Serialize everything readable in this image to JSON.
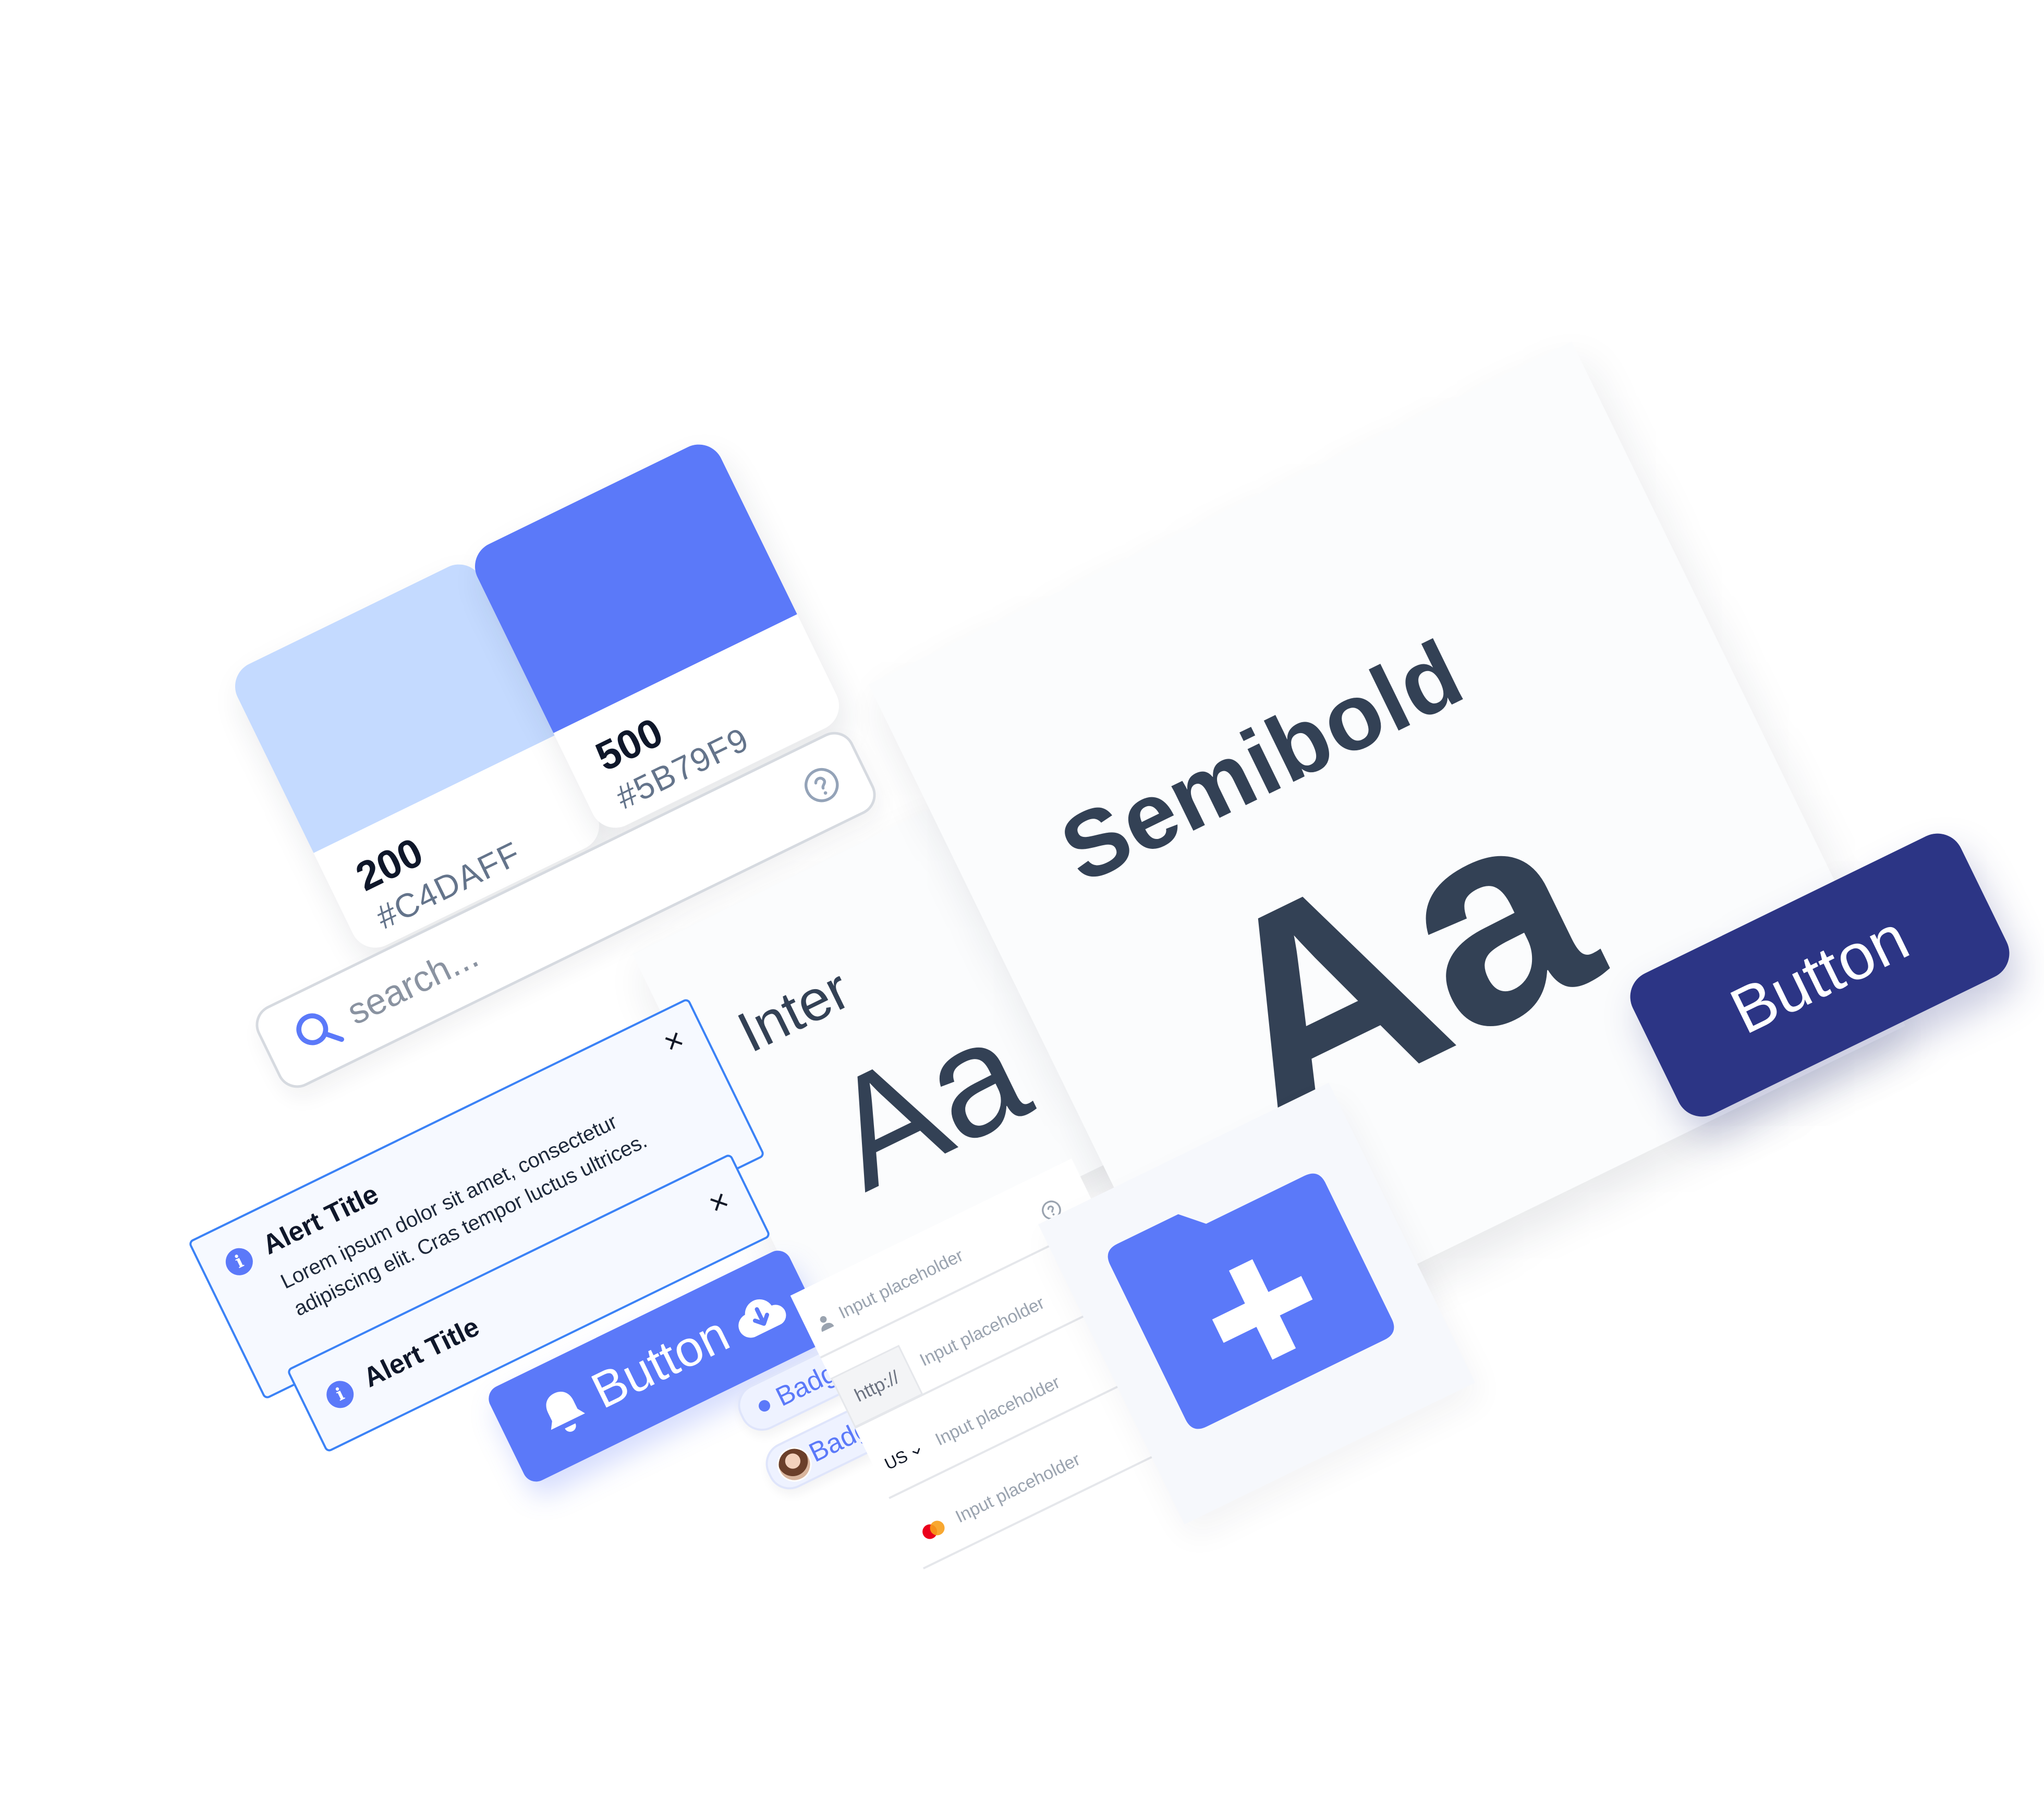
{
  "swatches": [
    {
      "level": "200",
      "hex": "#C4DAFF",
      "color": "#C4DAFF"
    },
    {
      "level": "500",
      "hex": "#5B79F9",
      "color": "#5B79F9"
    }
  ],
  "search": {
    "placeholder": "search..."
  },
  "alerts": [
    {
      "title": "Alert Title",
      "body": "Lorem ipsum dolor sit amet, consectetur adipiscing elit. Cras tempor luctus ultrices.",
      "close": "×"
    },
    {
      "title": "Alert Title",
      "close": "×"
    }
  ],
  "alert_icon": "i",
  "typography": [
    {
      "name": "Inter",
      "sample": "Aa"
    },
    {
      "name": "Semibold",
      "sample": "Aa"
    }
  ],
  "buttons": {
    "dark_label": "Button",
    "blue_label": "Button"
  },
  "badges": [
    {
      "label": "Badge",
      "kind": "dot"
    },
    {
      "label": "Badge",
      "kind": "avatar"
    }
  ],
  "inputs": {
    "placeholder": "Input placeholder",
    "url_prefix": "http://",
    "country": "US",
    "icons": [
      "user-icon",
      "help-circle-icon",
      "chevron-down-icon",
      "mastercard-icon"
    ]
  },
  "colors": {
    "primary": "#5B79F9",
    "primary_light": "#C4DAFF",
    "navy": "#2C3585",
    "text_dark": "#334155",
    "muted": "#64748B"
  }
}
